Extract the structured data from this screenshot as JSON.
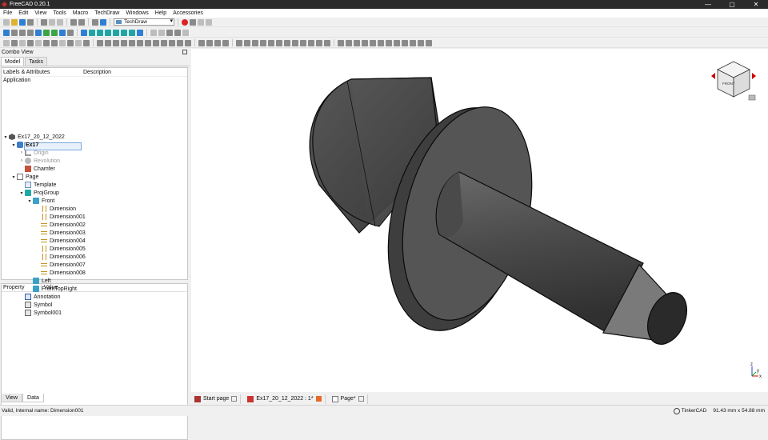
{
  "window": {
    "title": "FreeCAD 0.20.1",
    "controls": [
      "—",
      "▢",
      "✕"
    ]
  },
  "menu": [
    "File",
    "Edit",
    "View",
    "Tools",
    "Macro",
    "TechDraw",
    "Windows",
    "Help",
    "Accessories"
  ],
  "toolbar": {
    "workbench": "TechDraw"
  },
  "combo_view": {
    "title": "Combo View",
    "tabs": [
      "Model",
      "Tasks"
    ],
    "tree_headers": [
      "Labels & Attributes",
      "Description"
    ],
    "section": "Application",
    "tree": [
      {
        "label": "Ex17_20_12_2022",
        "level": 0,
        "arrow": "▾",
        "icon": "document-icon"
      },
      {
        "label": "Ex17",
        "level": 1,
        "arrow": "▾",
        "icon": "body-icon",
        "selected": true
      },
      {
        "label": "Origin",
        "level": 2,
        "arrow": "›",
        "icon": "origin-icon",
        "dim": true
      },
      {
        "label": "Revolution",
        "level": 2,
        "arrow": "›",
        "icon": "revolution-icon",
        "dim": true
      },
      {
        "label": "Chamfer",
        "level": 2,
        "arrow": "",
        "icon": "chamfer-icon"
      },
      {
        "label": "Page",
        "level": 1,
        "arrow": "▾",
        "icon": "page-icon"
      },
      {
        "label": "Template",
        "level": 2,
        "arrow": "",
        "icon": "template-icon"
      },
      {
        "label": "ProjGroup",
        "level": 2,
        "arrow": "▾",
        "icon": "projgroup-icon"
      },
      {
        "label": "Front",
        "level": 3,
        "arrow": "▾",
        "icon": "view-icon"
      },
      {
        "label": "Dimension",
        "level": 4,
        "arrow": "",
        "icon": "dim-vertical-icon"
      },
      {
        "label": "Dimension001",
        "level": 4,
        "arrow": "",
        "icon": "dim-vertical-icon"
      },
      {
        "label": "Dimension002",
        "level": 4,
        "arrow": "",
        "icon": "dim-horizontal-icon"
      },
      {
        "label": "Dimension003",
        "level": 4,
        "arrow": "",
        "icon": "dim-horizontal-icon"
      },
      {
        "label": "Dimension004",
        "level": 4,
        "arrow": "",
        "icon": "dim-horizontal-icon"
      },
      {
        "label": "Dimension005",
        "level": 4,
        "arrow": "",
        "icon": "dim-vertical-icon"
      },
      {
        "label": "Dimension006",
        "level": 4,
        "arrow": "",
        "icon": "dim-vertical-icon"
      },
      {
        "label": "Dimension007",
        "level": 4,
        "arrow": "",
        "icon": "dim-horizontal-icon"
      },
      {
        "label": "Dimension008",
        "level": 4,
        "arrow": "",
        "icon": "dim-horizontal-icon"
      },
      {
        "label": "Left",
        "level": 3,
        "arrow": "",
        "icon": "view-icon"
      },
      {
        "label": "FrontTopRight",
        "level": 3,
        "arrow": "",
        "icon": "view-icon"
      },
      {
        "label": "Annotation",
        "level": 2,
        "arrow": "",
        "icon": "annotation-icon"
      },
      {
        "label": "Symbol",
        "level": 2,
        "arrow": "",
        "icon": "symbol-icon"
      },
      {
        "label": "Symbol001",
        "level": 2,
        "arrow": "",
        "icon": "symbol-icon"
      }
    ],
    "property_headers": [
      "Property",
      "Value"
    ],
    "bottom_tabs": [
      "View",
      "Data"
    ]
  },
  "doc_tabs": [
    {
      "label": "Start page",
      "icon": "start-page-icon"
    },
    {
      "label": "Ex17_20_12_2022 : 1*",
      "icon": "freecad-doc-icon",
      "active": true
    },
    {
      "label": "Page*",
      "icon": "page-icon"
    }
  ],
  "navcube": {
    "face": "FRONT"
  },
  "axis": {
    "x": "x",
    "y": "y",
    "z": "z"
  },
  "status": {
    "message": "Valid, Internal name: Dimension001",
    "nav_style": "TinkerCAD",
    "dimensions": "91.43 mm x 54.88 mm"
  },
  "colors": {
    "titlebar": "#2b2b2b",
    "selection": "#e8f1fb",
    "record": "#d22222"
  }
}
